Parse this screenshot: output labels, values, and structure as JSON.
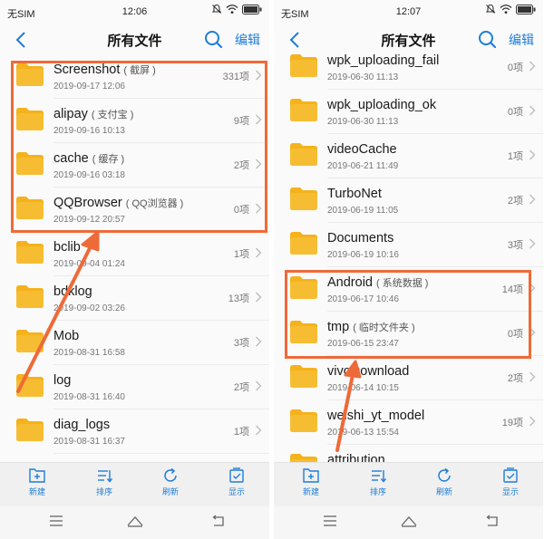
{
  "left": {
    "status": {
      "carrier": "无SIM",
      "time": "12:06"
    },
    "header": {
      "title": "所有文件",
      "edit": "编辑"
    },
    "files": [
      {
        "name": "Screenshot",
        "sub": "( 截屏 )",
        "date": "2019-09-17 12:06",
        "count": "331项"
      },
      {
        "name": "alipay",
        "sub": "( 支付宝 )",
        "date": "2019-09-16 10:13",
        "count": "9项"
      },
      {
        "name": "cache",
        "sub": "( 缓存 )",
        "date": "2019-09-16 03:18",
        "count": "2项"
      },
      {
        "name": "QQBrowser",
        "sub": "( QQ浏览器 )",
        "date": "2019-09-12 20:57",
        "count": "0项"
      },
      {
        "name": "bclib",
        "sub": "",
        "date": "2019-09-04 01:24",
        "count": "1项"
      },
      {
        "name": "bdklog",
        "sub": "",
        "date": "2019-09-02 03:26",
        "count": "13项"
      },
      {
        "name": "Mob",
        "sub": "",
        "date": "2019-08-31 16:58",
        "count": "3项"
      },
      {
        "name": "log",
        "sub": "",
        "date": "2019-08-31 16:40",
        "count": "2项"
      },
      {
        "name": "diag_logs",
        "sub": "",
        "date": "2019-08-31 16:37",
        "count": "1项"
      }
    ],
    "toolbar": [
      "新建",
      "排序",
      "刷新",
      "显示"
    ]
  },
  "right": {
    "status": {
      "carrier": "无SIM",
      "time": "12:07"
    },
    "header": {
      "title": "所有文件",
      "edit": "编辑"
    },
    "files": [
      {
        "name": "wpk_uploading_fail",
        "sub": "",
        "date": "2019-06-30 11:13",
        "count": "0项"
      },
      {
        "name": "wpk_uploading_ok",
        "sub": "",
        "date": "2019-06-30 11:13",
        "count": "0项"
      },
      {
        "name": "videoCache",
        "sub": "",
        "date": "2019-06-21 11:49",
        "count": "1项"
      },
      {
        "name": "TurboNet",
        "sub": "",
        "date": "2019-06-19 11:05",
        "count": "2项"
      },
      {
        "name": "Documents",
        "sub": "",
        "date": "2019-06-19 10:16",
        "count": "3项"
      },
      {
        "name": "Android",
        "sub": "( 系统数据 )",
        "date": "2019-06-17 10:46",
        "count": "14项"
      },
      {
        "name": "tmp",
        "sub": "( 临时文件夹 )",
        "date": "2019-06-15 23:47",
        "count": "0项"
      },
      {
        "name": "vivoDownload",
        "sub": "",
        "date": "2019-06-14 10:15",
        "count": "2项"
      },
      {
        "name": "weishi_yt_model",
        "sub": "",
        "date": "2019-06-13 15:54",
        "count": "19项"
      },
      {
        "name": "attribution",
        "sub": "",
        "date": "",
        "count": ""
      }
    ],
    "toolbar": [
      "新建",
      "排序",
      "刷新",
      "显示"
    ]
  },
  "colors": {
    "accent": "#1e7ed8",
    "folder": "#f5b21b",
    "highlight": "#ee6a38"
  },
  "icons": [
    "back-icon",
    "search-icon",
    "mute-icon",
    "wifi-icon",
    "battery-icon",
    "folder-icon",
    "chevron-right-icon",
    "new-folder-icon",
    "sort-icon",
    "refresh-icon",
    "display-icon",
    "menu-icon",
    "home-icon",
    "return-icon"
  ]
}
